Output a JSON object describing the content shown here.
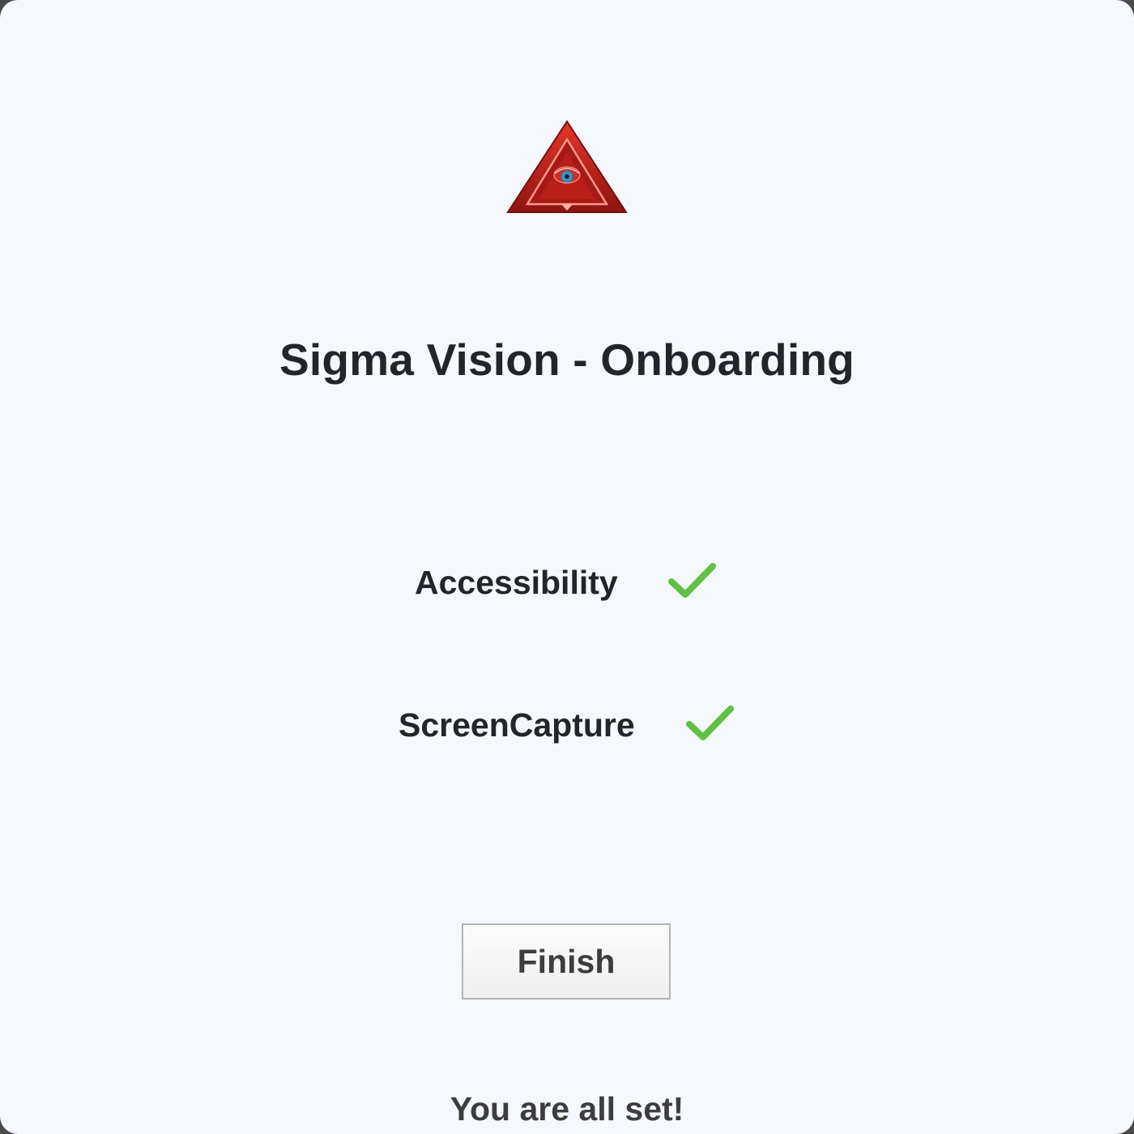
{
  "app": {
    "title": "Sigma Vision - Onboarding",
    "logo_icon": "eye-pyramid-icon"
  },
  "permissions": [
    {
      "label": "Accessibility",
      "granted": true,
      "icon": "checkmark-icon"
    },
    {
      "label": "ScreenCapture",
      "granted": true,
      "icon": "checkmark-icon"
    }
  ],
  "actions": {
    "finish_label": "Finish"
  },
  "status": {
    "message": "You are all set!"
  },
  "colors": {
    "background": "#f5f8fd",
    "text": "#22262b",
    "check_green": "#5cc23f",
    "logo_red": "#c0221a"
  }
}
